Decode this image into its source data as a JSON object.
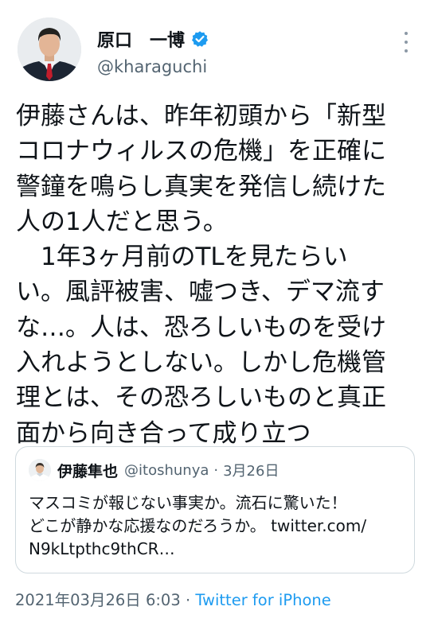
{
  "author": {
    "display_name": "原口　一博",
    "handle": "@kharaguchi",
    "verified": true
  },
  "tweet": {
    "lines": [
      "伊藤さんは、昨年初頭から「新型",
      "コロナウィルスの危機」を正確に",
      "警鐘を鳴らし真実を発信し続けた",
      "人の1人だと思う。",
      "　1年3ヶ月前のTLを見たらい",
      "い。風評被害、嘘つき、デマ流す",
      "な…。人は、恐ろしいものを受け",
      "入れようとしない。しかし危機管",
      "理とは、その恐ろしいものと真正",
      "面から向き合って成り立つ"
    ]
  },
  "quote": {
    "display_name": "伊藤隼也",
    "handle": "@itoshunya",
    "separator": "·",
    "date": "3月26日",
    "lines": [
      "マスコミが報じない事実か。流石に驚いた！",
      "どこが静かな応援なのだろうか。 twitter.com/",
      "N9kLtpthc9thCR…"
    ]
  },
  "footer": {
    "timestamp": "2021年03月26日 6:03",
    "separator": "·",
    "source": "Twitter for iPhone"
  },
  "colors": {
    "text": "#0f1419",
    "secondary": "#536471",
    "accent": "#1d9bf0",
    "border": "#cfd9de"
  },
  "icons": {
    "verified": "verified-badge-icon",
    "more": "more-vertical-icon"
  }
}
